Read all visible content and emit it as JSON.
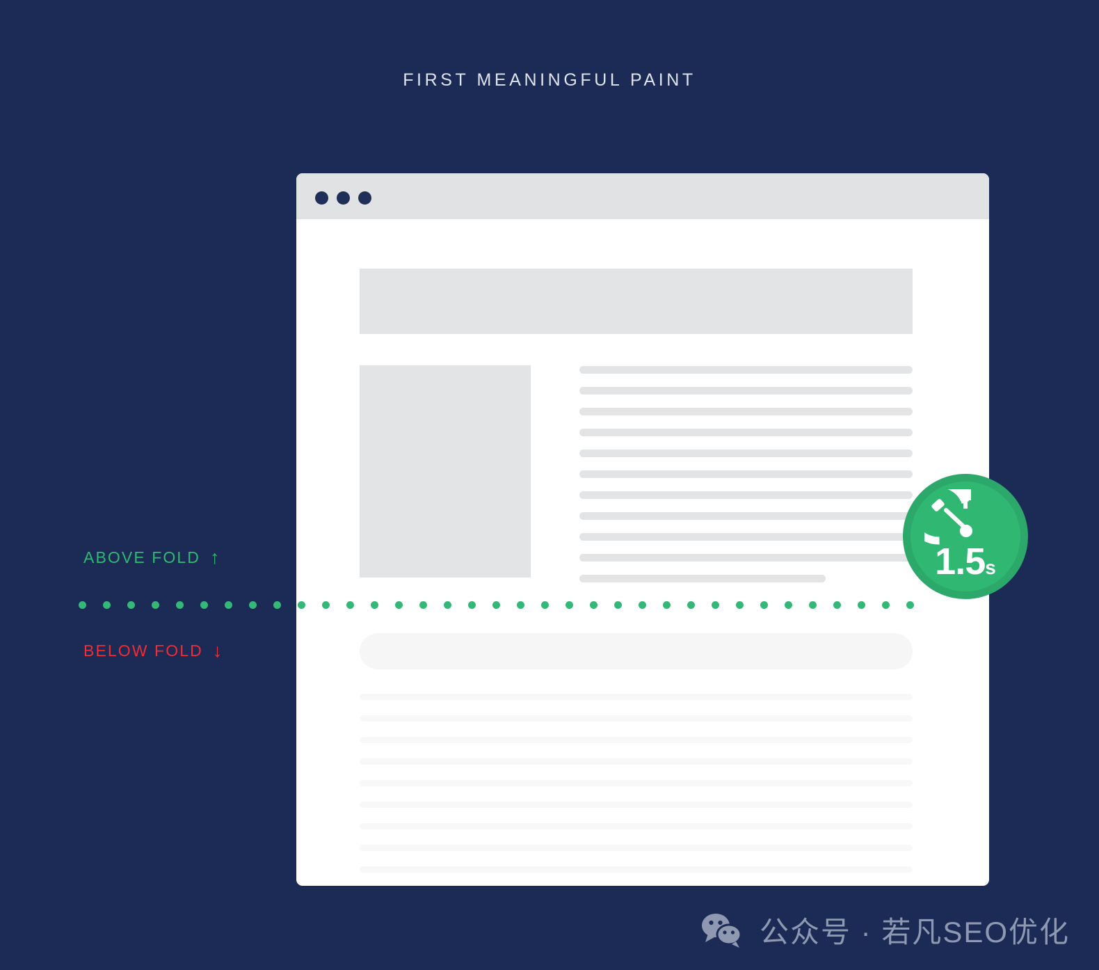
{
  "title": "FIRST MEANINGFUL PAINT",
  "colors": {
    "background": "#1b2b55",
    "title_text": "#dfe3ec",
    "skeleton_gray": "#e3e4e5",
    "skeleton_faint": "#f8f8f9",
    "above_fold_green": "#2fba72",
    "below_fold_red": "#f42b33",
    "fold_dot_green": "#34b877",
    "badge_ring": "#2ba86a",
    "badge_fill": "#30b873",
    "titlebar_gray": "#e1e2e3",
    "watermark_gray": "#a3acc2"
  },
  "browser": {
    "titlebar": {
      "dots": [
        "window-dot-1",
        "window-dot-2",
        "window-dot-3"
      ]
    },
    "above_fold": {
      "hero_banner": "hero-banner-placeholder",
      "image_placeholder": "image-placeholder",
      "text_line_count": 11,
      "last_line_width_percent": 74
    },
    "below_fold": {
      "cta_pill": "cta-pill-placeholder",
      "text_line_count": 9
    }
  },
  "fold": {
    "above_label": "ABOVE FOLD",
    "above_arrow": "↑",
    "below_label": "BELOW FOLD",
    "below_arrow": "↓",
    "divider_dot_count": 35
  },
  "badge": {
    "value": "1.5",
    "unit": "s",
    "icon": "stopwatch-icon"
  },
  "watermark": {
    "icon": "wechat-icon",
    "text": "公众号 · 若凡SEO优化"
  }
}
